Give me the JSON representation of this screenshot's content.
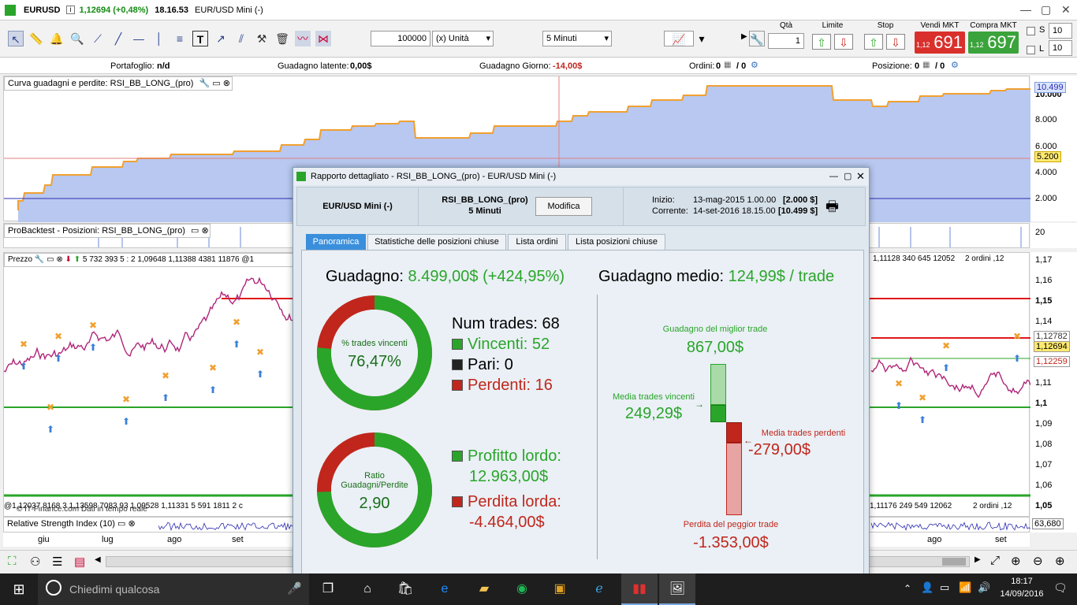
{
  "title": {
    "symbol": "EURUSD",
    "price_change": "1,12694 (+0,48%)",
    "time": "18.16.53",
    "instrument": "EUR/USD Mini (-)"
  },
  "toolbar": {
    "quantity_value": "100000",
    "unit_select": "(x) Unità",
    "timeframe_select": "5 Minuti",
    "qta_label": "Qtà",
    "qta_value": "1",
    "limite_label": "Limite",
    "stop_label": "Stop",
    "sell_label": "Vendi MKT",
    "buy_label": "Compra MKT",
    "sell_small": "1,12",
    "sell_big": "691",
    "buy_small": "1,12",
    "buy_big": "697",
    "s_label": "S",
    "l_label": "L",
    "s_value": "10",
    "l_value": "10"
  },
  "infobar": {
    "portfolio_label": "Portafoglio:",
    "portfolio_value": "n/d",
    "latent_label": "Guadagno latente:",
    "latent_value": "0,00$",
    "daily_label": "Guadagno Giorno:",
    "daily_value": "-14,00$",
    "orders_label": "Ordini:",
    "orders_value": "0",
    "orders_sep": "/ 0",
    "position_label": "Posizione:",
    "position_value": "0",
    "position_sep": "/ 0"
  },
  "panels": {
    "equity_header": "Curva guadagni e perdite: RSI_BB_LONG_(pro)",
    "positions_header": "ProBacktest - Posizioni: RSI_BB_LONG_(pro)",
    "price_header": "Prezzo",
    "price_header_values": "5 732 393 5 : 2 1,09648 1,11388 4381 11876 @1",
    "price_right_values": "1,11128 340 645 12052",
    "price_right_orders": "2 ordini ,12",
    "price_bottom_left": "@1,12037 8168 3 1,13598 7083 93 1,09528 1,11331 5 591 1811 2 c",
    "price_bottom_right": "1,11176 249 549 12062",
    "price_bottom_orders": "2 ordini ,12",
    "credit": "© IT-Finance.com Dati in tempo reale",
    "rsi_header": "Relative Strength Index (10)",
    "rsi_value": "63,680"
  },
  "equity_axis": [
    "10.000",
    "8.000",
    "6.000",
    "4.000",
    "2.000"
  ],
  "equity_tags": {
    "current": "10.499",
    "initial": "5.200"
  },
  "positions_axis": "20",
  "price_axis": [
    "1,17",
    "1,16",
    "1,15",
    "1,14",
    "1,13",
    "1,12",
    "1,11",
    "1,1",
    "1,09",
    "1,08",
    "1,07",
    "1,06",
    "1,05"
  ],
  "price_tags": {
    "last": "1,12694",
    "bb_upper": "1,12782",
    "bb_lower": "1,12259"
  },
  "x_axis": [
    "giu",
    "lug",
    "ago",
    "set",
    "ago",
    "set"
  ],
  "dialog": {
    "title": "Rapporto dettagliato - RSI_BB_LONG_(pro) - EUR/USD Mini (-)",
    "instrument": "EUR/USD Mini (-)",
    "system": "RSI_BB_LONG_(pro)",
    "timeframe": "5 Minuti",
    "modify_button": "Modifica",
    "start_label": "Inizio:",
    "start_value": "13-mag-2015 1.00.00",
    "start_capital": "[2.000 $]",
    "current_label": "Corrente:",
    "current_value": "14-set-2016 18.15.00",
    "current_capital": "[10.499 $]",
    "tabs": [
      "Panoramica",
      "Statistiche delle posizioni chiuse",
      "Lista ordini",
      "Lista posizioni chiuse"
    ],
    "gain_label": "Guadagno:",
    "gain_value": "8.499,00$ (+424,95%)",
    "avg_label": "Guadagno medio:",
    "avg_value": "124,99$ / trade",
    "donut1_label": "% trades vincenti",
    "donut1_value": "76,47%",
    "donut1_fraction": 0.7647,
    "donut2_label": "Ratio Guadagni/Perdite",
    "donut2_value": "2,90",
    "donut2_fraction": 0.7438,
    "num_trades_label": "Num trades:",
    "num_trades_value": "68",
    "winners_label": "Vincenti:",
    "winners_value": "52",
    "even_label": "Pari:",
    "even_value": "0",
    "losers_label": "Perdenti:",
    "losers_value": "16",
    "gross_profit_label": "Profitto lordo:",
    "gross_profit_value": "12.963,00$",
    "gross_loss_label": "Perdita lorda:",
    "gross_loss_value": "-4.464,00$",
    "best_label": "Guadagno del miglior trade",
    "best_value": "867,00$",
    "avg_win_label": "Media trades vincenti",
    "avg_win_value": "249,29$",
    "avg_loss_label": "Media trades perdenti",
    "avg_loss_value": "-279,00$",
    "worst_label": "Perdita del peggior trade",
    "worst_value": "-1.353,00$"
  },
  "taskbar": {
    "search_placeholder": "Chiedimi qualcosa",
    "clock_time": "18:17",
    "clock_date": "14/09/2016"
  },
  "colors": {
    "gain": "#2aa52a",
    "loss": "#c0261c",
    "equity_line": "#f0a030",
    "equity_fill": "#b8c8f0",
    "price_line": "#b0267a",
    "accent": "#3a8fdc"
  }
}
